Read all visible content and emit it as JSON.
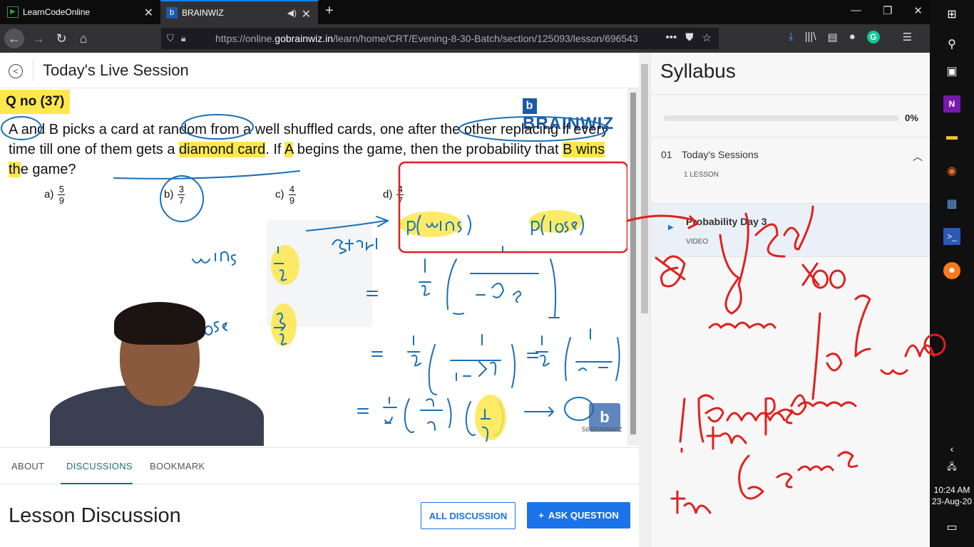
{
  "browser": {
    "tabs": [
      {
        "title": "LearnCodeOnline",
        "active": false
      },
      {
        "title": "BRAINWIZ",
        "active": true
      }
    ],
    "url_prefix": "https://online.",
    "url_host": "gobrainwiz.in",
    "url_path": "/learn/home/CRT/Evening-8-30-Batch/section/125093/lesson/696543",
    "grammarly": "G"
  },
  "lesson": {
    "title": "Today's Live Session"
  },
  "video": {
    "qno": "Q no (37)",
    "brand": "BRAINWIZ",
    "brand_mark": "b",
    "question_parts": {
      "p1": "A and B picks a card at random from a well shuffled cards, one after the other replacing if every time till one of them gets a ",
      "p2": "diamond card",
      "p3": ". If ",
      "p4": "A",
      "p5": " begins the game, then the probability that ",
      "p6": "B wins th",
      "p7": "e game?"
    },
    "options": [
      {
        "label": "a)",
        "num": "5",
        "den": "9"
      },
      {
        "label": "b)",
        "num": "3",
        "den": "7"
      },
      {
        "label": "c)",
        "num": "4",
        "den": "9"
      },
      {
        "label": "d)",
        "num": "4",
        "den": "7"
      }
    ],
    "watermark_small": "56",
    "watermark_small_text": "BRAINWIZ"
  },
  "bottom_tabs": [
    "ABOUT",
    "DISCUSSIONS",
    "BOOKMARK"
  ],
  "discussion": {
    "title": "Lesson Discussion",
    "all_btn": "ALL DISCUSSION",
    "ask_btn": "ASK QUESTION",
    "ask_icon": "+"
  },
  "syllabus": {
    "title": "Syllabus",
    "progress_pct": 0,
    "progress_label": "0%",
    "section_num": "01",
    "section_title": "Today's Sessions",
    "section_sub": "1 LESSON",
    "lesson_name": "Probability Day 3",
    "lesson_type": "VIDEO"
  },
  "taskbar": {
    "time": "10:24 AM",
    "date": "23-Aug-20"
  },
  "colors": {
    "accent": "#1a73e8",
    "highlight": "#fde74c",
    "ink_blue": "#1a6fb5",
    "ink_red": "#e0201e"
  }
}
